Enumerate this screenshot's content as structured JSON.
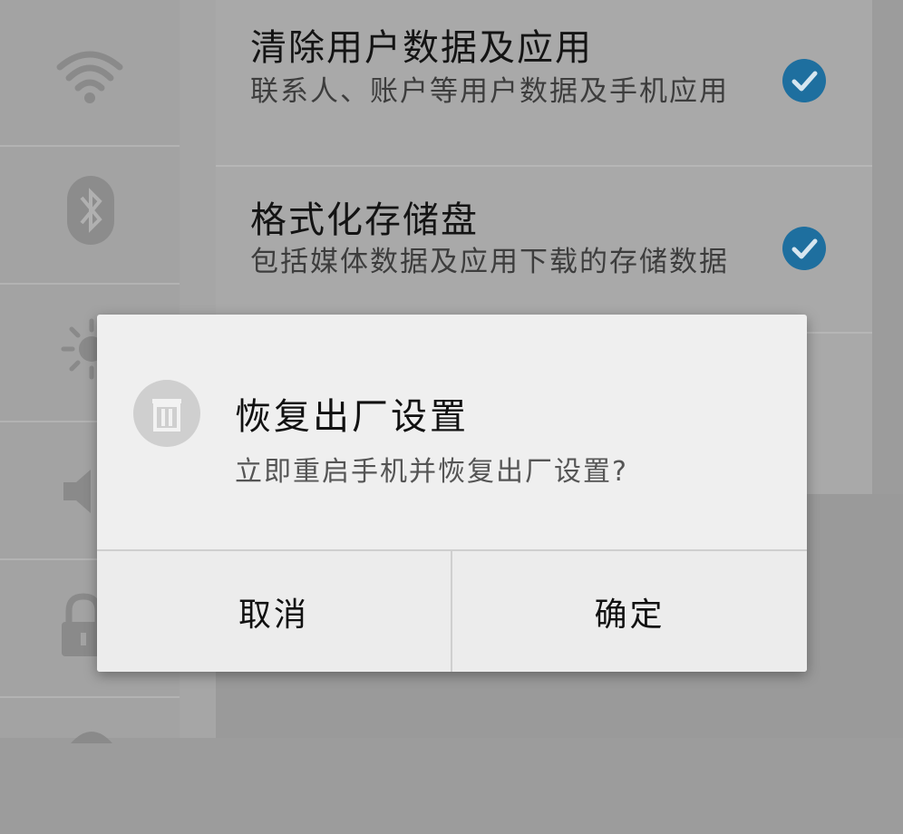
{
  "sidebar": {
    "icons": [
      {
        "name": "wifi-icon"
      },
      {
        "name": "bluetooth-icon"
      },
      {
        "name": "brightness-icon"
      },
      {
        "name": "volume-icon"
      },
      {
        "name": "lock-icon"
      },
      {
        "name": "settings-icon"
      }
    ]
  },
  "options": [
    {
      "title": "清除用户数据及应用",
      "description": "联系人、账户等用户数据及手机应用",
      "checked": true
    },
    {
      "title": "格式化存储盘",
      "description": "包括媒体数据及应用下载的存储数据",
      "checked": true
    }
  ],
  "dialog": {
    "icon": "trash-icon",
    "title": "恢复出厂设置",
    "message": "立即重启手机并恢复出厂设置?",
    "cancel_label": "取消",
    "confirm_label": "确定"
  },
  "colors": {
    "checkmark": "#1e6f9f",
    "dialog_background": "#efefef",
    "dim_overlay": "#9c9c9c"
  }
}
